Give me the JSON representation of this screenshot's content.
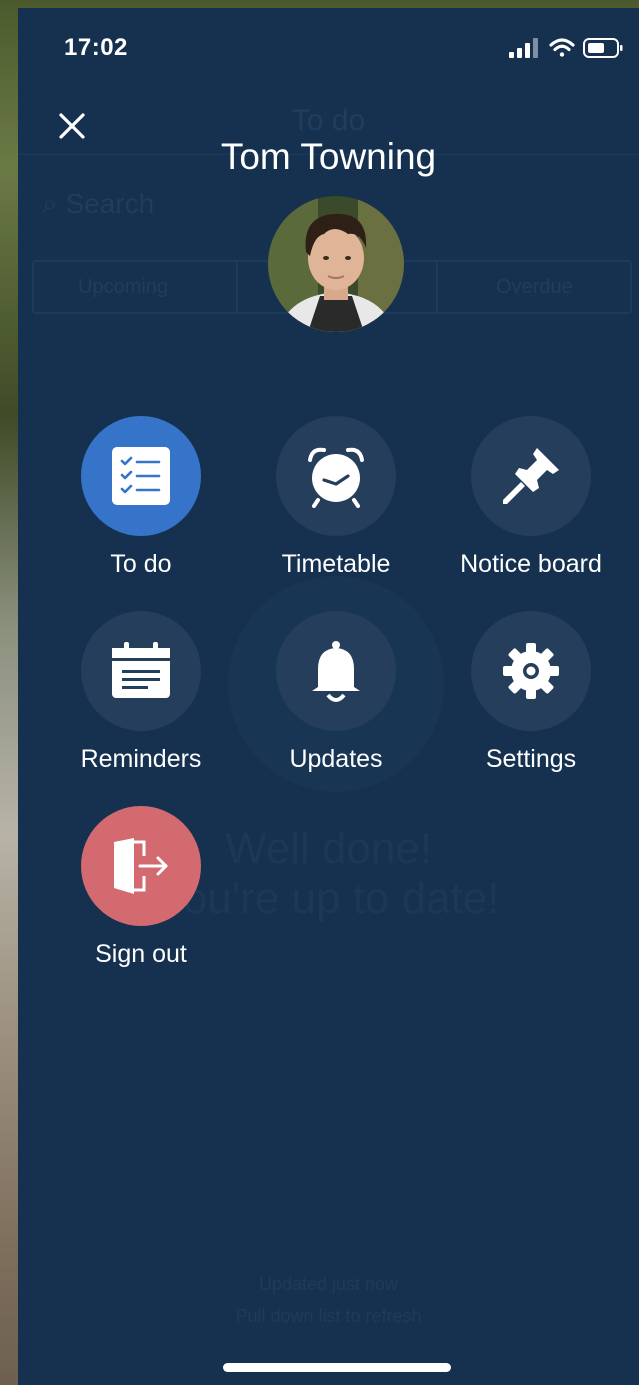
{
  "status_bar": {
    "time": "17:02"
  },
  "background_page": {
    "title": "To do",
    "search_placeholder": "Search",
    "tabs": [
      "Upcoming",
      "Overdue"
    ],
    "empty_line1": "Well done!",
    "empty_line2": "You're up to date!",
    "footer_line1": "Updated just now",
    "footer_line2": "Pull down list to refresh"
  },
  "menu": {
    "user_name": "Tom Towning",
    "items": [
      {
        "label": "To do",
        "icon": "checklist-icon",
        "state": "active"
      },
      {
        "label": "Timetable",
        "icon": "alarm-clock-icon"
      },
      {
        "label": "Notice board",
        "icon": "pushpin-icon"
      },
      {
        "label": "Reminders",
        "icon": "calendar-icon"
      },
      {
        "label": "Updates",
        "icon": "bell-icon"
      },
      {
        "label": "Settings",
        "icon": "gear-icon"
      },
      {
        "label": "Sign out",
        "icon": "sign-out-icon",
        "state": "danger"
      }
    ]
  },
  "colors": {
    "panel": "#15314f",
    "tile": "#243e5c",
    "active": "#3574c8",
    "danger": "#d36a70"
  }
}
